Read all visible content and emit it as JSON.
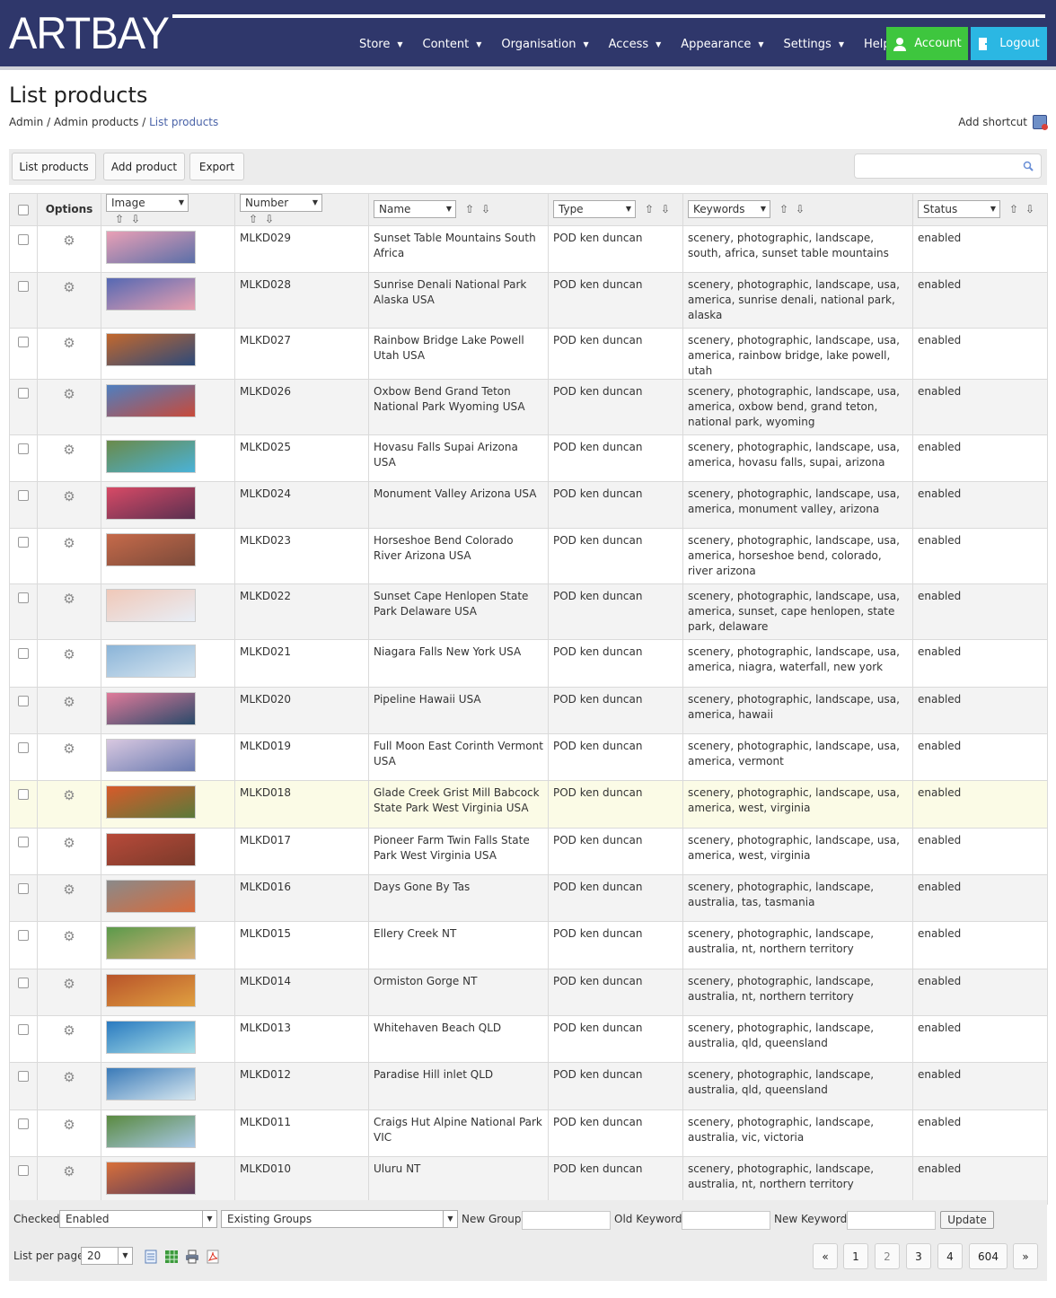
{
  "header": {
    "logo": "ARTBAY",
    "nav": [
      "Store",
      "Content",
      "Organisation",
      "Access",
      "Appearance",
      "Settings",
      "Help"
    ],
    "account_label": "Account",
    "logout_label": "Logout",
    "colors": {
      "header_bg": "#2f376b",
      "account": "#3ec63e",
      "logout": "#2bb7e3"
    }
  },
  "page": {
    "title": "List products",
    "breadcrumb": [
      "Admin",
      "Admin products",
      "List products"
    ],
    "add_shortcut": "Add shortcut"
  },
  "toolbar": {
    "list_products": "List products",
    "add_product": "Add product",
    "export": "Export",
    "search_placeholder": ""
  },
  "table": {
    "options_header": "Options",
    "filters": [
      "Image",
      "Number",
      "Name",
      "Type",
      "Keywords",
      "Status"
    ],
    "rows": [
      {
        "number": "MLKD029",
        "name": "Sunset Table Mountains South Africa",
        "type": "POD ken duncan",
        "keywords": "scenery, photographic, landscape, south, africa, sunset table mountains",
        "status": "enabled"
      },
      {
        "number": "MLKD028",
        "name": "Sunrise Denali National Park Alaska USA",
        "type": "POD ken duncan",
        "keywords": "scenery, photographic, landscape, usa, america, sunrise denali, national park, alaska",
        "status": "enabled"
      },
      {
        "number": "MLKD027",
        "name": "Rainbow Bridge Lake Powell Utah USA",
        "type": "POD ken duncan",
        "keywords": "scenery, photographic, landscape, usa, america, rainbow bridge, lake powell, utah",
        "status": "enabled"
      },
      {
        "number": "MLKD026",
        "name": "Oxbow Bend Grand Teton National Park Wyoming USA",
        "type": "POD ken duncan",
        "keywords": "scenery, photographic, landscape, usa, america, oxbow bend, grand teton, national park, wyoming",
        "status": "enabled"
      },
      {
        "number": "MLKD025",
        "name": "Hovasu Falls Supai Arizona USA",
        "type": "POD ken duncan",
        "keywords": "scenery, photographic, landscape, usa, america, hovasu falls, supai, arizona",
        "status": "enabled"
      },
      {
        "number": "MLKD024",
        "name": "Monument Valley Arizona USA",
        "type": "POD ken duncan",
        "keywords": "scenery, photographic, landscape, usa, america, monument valley, arizona",
        "status": "enabled"
      },
      {
        "number": "MLKD023",
        "name": "Horseshoe Bend Colorado River Arizona USA",
        "type": "POD ken duncan",
        "keywords": "scenery, photographic, landscape, usa, america, horseshoe bend, colorado, river arizona",
        "status": "enabled"
      },
      {
        "number": "MLKD022",
        "name": "Sunset Cape Henlopen State Park Delaware USA",
        "type": "POD ken duncan",
        "keywords": "scenery, photographic, landscape, usa, america, sunset, cape henlopen, state park, delaware",
        "status": "enabled"
      },
      {
        "number": "MLKD021",
        "name": "Niagara Falls New York USA",
        "type": "POD ken duncan",
        "keywords": "scenery, photographic, landscape, usa, america, niagra, waterfall, new york",
        "status": "enabled"
      },
      {
        "number": "MLKD020",
        "name": "Pipeline Hawaii USA",
        "type": "POD ken duncan",
        "keywords": "scenery, photographic, landscape, usa, america, hawaii",
        "status": "enabled"
      },
      {
        "number": "MLKD019",
        "name": "Full Moon East Corinth Vermont USA",
        "type": "POD ken duncan",
        "keywords": "scenery, photographic, landscape, usa, america, vermont",
        "status": "enabled"
      },
      {
        "number": "MLKD018",
        "name": "Glade Creek Grist Mill Babcock State Park West Virginia USA",
        "type": "POD ken duncan",
        "keywords": "scenery, photographic, landscape, usa, america, west, virginia",
        "status": "enabled"
      },
      {
        "number": "MLKD017",
        "name": "Pioneer Farm Twin Falls State Park West Virginia USA",
        "type": "POD ken duncan",
        "keywords": "scenery, photographic, landscape, usa, america, west, virginia",
        "status": "enabled"
      },
      {
        "number": "MLKD016",
        "name": "Days Gone By Tas",
        "type": "POD ken duncan",
        "keywords": "scenery, photographic, landscape, australia, tas, tasmania",
        "status": "enabled"
      },
      {
        "number": "MLKD015",
        "name": "Ellery Creek NT",
        "type": "POD ken duncan",
        "keywords": "scenery, photographic, landscape, australia, nt, northern territory",
        "status": "enabled"
      },
      {
        "number": "MLKD014",
        "name": "Ormiston Gorge NT",
        "type": "POD ken duncan",
        "keywords": "scenery, photographic, landscape, australia, nt, northern territory",
        "status": "enabled"
      },
      {
        "number": "MLKD013",
        "name": "Whitehaven Beach QLD",
        "type": "POD ken duncan",
        "keywords": "scenery, photographic, landscape, australia, qld, queensland",
        "status": "enabled"
      },
      {
        "number": "MLKD012",
        "name": "Paradise Hill inlet QLD",
        "type": "POD ken duncan",
        "keywords": "scenery, photographic, landscape, australia, qld, queensland",
        "status": "enabled"
      },
      {
        "number": "MLKD011",
        "name": "Craigs Hut Alpine National Park VIC",
        "type": "POD ken duncan",
        "keywords": "scenery, photographic, landscape, australia, vic, victoria",
        "status": "enabled"
      },
      {
        "number": "MLKD010",
        "name": "Uluru NT",
        "type": "POD ken duncan",
        "keywords": "scenery, photographic, landscape, australia, nt, northern territory",
        "status": "enabled"
      }
    ]
  },
  "bottom": {
    "checked_label": "Checked",
    "checked_value": "Enabled",
    "groups_value": "Existing Groups",
    "new_group_label": "New Group",
    "old_keyword_label": "Old Keyword",
    "new_keyword_label": "New Keyword",
    "update_label": "Update",
    "per_page_label": "List per page",
    "per_page_value": "20",
    "pagination": [
      "«",
      "1",
      "2",
      "3",
      "4",
      "604",
      "»"
    ],
    "current_page": "2"
  }
}
